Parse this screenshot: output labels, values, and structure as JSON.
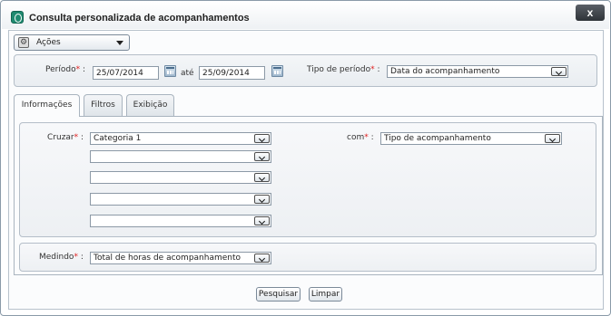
{
  "window": {
    "title": "Consulta personalizada de acompanhamentos",
    "close_label": "x"
  },
  "actions": {
    "label": "Ações"
  },
  "period": {
    "label": "Período",
    "required_mark": "*",
    "separator": ":",
    "start_value": "25/07/2014",
    "between_label": "até",
    "end_value": "25/09/2014",
    "type_label": "Tipo de período",
    "type_value": "Data do acompanhamento"
  },
  "tabs": [
    {
      "label": "Informações"
    },
    {
      "label": "Filtros"
    },
    {
      "label": "Exibição"
    }
  ],
  "cross": {
    "label": "Cruzar",
    "values": [
      "Categoria 1",
      "",
      "",
      "",
      ""
    ],
    "with_label": "com",
    "with_value": "Tipo de acompanhamento"
  },
  "measure": {
    "label": "Medindo",
    "value": "Total de horas de acompanhamento"
  },
  "buttons": {
    "search": "Pesquisar",
    "clear": "Limpar"
  }
}
